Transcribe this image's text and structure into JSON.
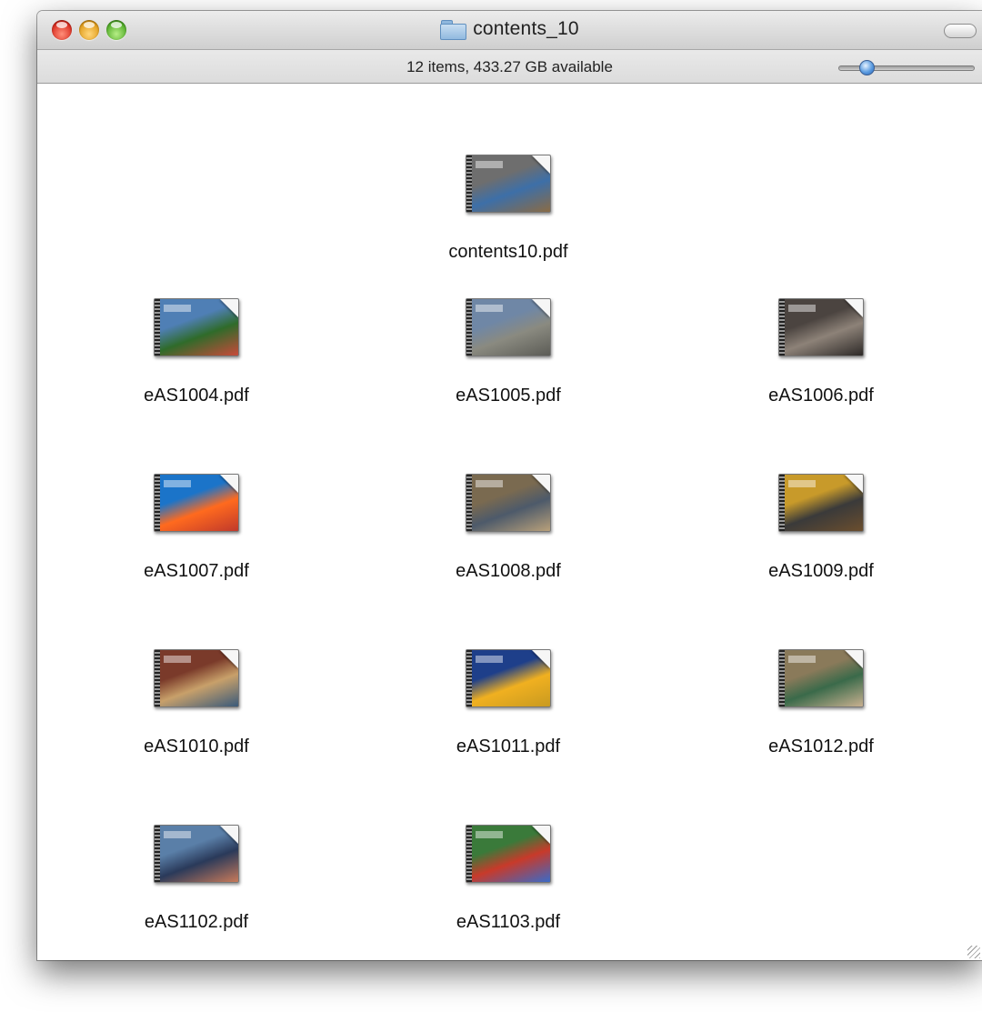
{
  "window": {
    "title": "contents_10",
    "status": "12 items, 433.27 GB available"
  },
  "icons": {
    "folder": "folder-icon",
    "pdf": "pdf-document-icon"
  },
  "items": [
    {
      "name": "contents10.pdf",
      "colors": [
        "#6e6e6e",
        "#3d6fa8",
        "#8a6b45"
      ]
    },
    {
      "name": "eAS1004.pdf",
      "colors": [
        "#4f7fb5",
        "#2f6b2a",
        "#c84a3a"
      ]
    },
    {
      "name": "eAS1005.pdf",
      "colors": [
        "#6f87a6",
        "#8a8a80",
        "#5c5c56"
      ]
    },
    {
      "name": "eAS1006.pdf",
      "colors": [
        "#4b4440",
        "#8d8278",
        "#2e2a28"
      ]
    },
    {
      "name": "eAS1007.pdf",
      "colors": [
        "#1b74c9",
        "#ff6a1e",
        "#c0392b"
      ]
    },
    {
      "name": "eAS1008.pdf",
      "colors": [
        "#7a6a50",
        "#4d5a6a",
        "#b8a07a"
      ]
    },
    {
      "name": "eAS1009.pdf",
      "colors": [
        "#c89a2a",
        "#3a3a3a",
        "#6b4e2e"
      ]
    },
    {
      "name": "eAS1010.pdf",
      "colors": [
        "#7a3a2a",
        "#c8a06a",
        "#3a5a7a"
      ]
    },
    {
      "name": "eAS1011.pdf",
      "colors": [
        "#1e3f8a",
        "#f0b020",
        "#c89a20"
      ]
    },
    {
      "name": "eAS1012.pdf",
      "colors": [
        "#8a7a5a",
        "#3a6a4a",
        "#c8b090"
      ]
    },
    {
      "name": "eAS1102.pdf",
      "colors": [
        "#5a7fa8",
        "#2a3a5a",
        "#c87a5a"
      ]
    },
    {
      "name": "eAS1103.pdf",
      "colors": [
        "#3a7a3a",
        "#c83a2a",
        "#3a6ac8"
      ]
    }
  ]
}
